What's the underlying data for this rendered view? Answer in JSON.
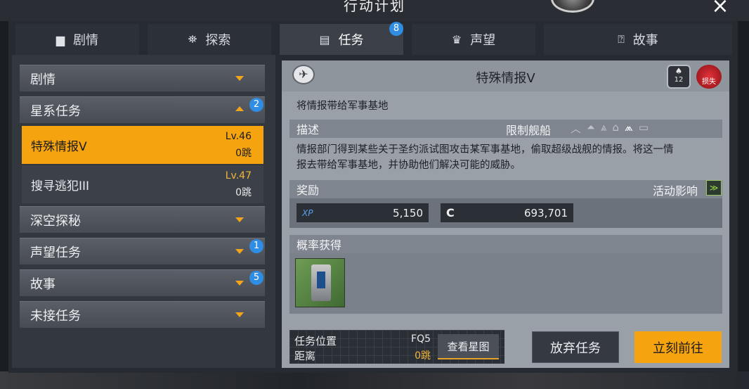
{
  "window": {
    "title": "行动计划",
    "close_icon": "×"
  },
  "tabs": [
    {
      "label": "剧情",
      "icon": "book-icon"
    },
    {
      "label": "探索",
      "icon": "explore-icon"
    },
    {
      "label": "任务",
      "icon": "task-icon",
      "badge": "8",
      "active": true
    },
    {
      "label": "声望",
      "icon": "reputation-icon"
    },
    {
      "label": "故事",
      "icon": "story-icon"
    }
  ],
  "sidebar": {
    "categories": [
      {
        "label": "剧情"
      },
      {
        "label": "星系任务",
        "badge": "2",
        "expanded": true
      },
      {
        "label": "深空探秘"
      },
      {
        "label": "声望任务",
        "badge": "1"
      },
      {
        "label": "故事",
        "badge": "5"
      },
      {
        "label": "未接任务"
      }
    ],
    "quests": [
      {
        "name": "特殊情报V",
        "level": "Lv.46",
        "jumps": "0跳",
        "selected": true
      },
      {
        "name": "搜寻逃犯III",
        "level": "Lv.47",
        "jumps": "0跳"
      }
    ]
  },
  "detail": {
    "title": "特殊情报V",
    "rank_text": "12",
    "danger_text": "损失",
    "objective_text": "将情报带给军事基地",
    "description_header": "描述",
    "restricted_ships_label": "限制舰船",
    "description_line1": "情报部门得到某些关于圣约派试图攻击某军事基地，偷取超级战舰的情报。将这一情",
    "description_line2": "报去带给军事基地，并协助他们解决可能的威胁。",
    "reward_header": "奖励",
    "activity_label": "活动影响",
    "rewards": [
      {
        "key": "XP",
        "value": "5,150"
      },
      {
        "key": "C",
        "value": "693,701"
      }
    ],
    "probability_header": "概率获得"
  },
  "footer": {
    "location_label": "任务位置",
    "distance_label": "距离",
    "location_value": "FQ5",
    "distance_value": "0跳",
    "view_starmap": "查看星图",
    "abandon": "放弃任务",
    "go_now": "立刻前往"
  },
  "colors": {
    "accent": "#f5a40f",
    "badge": "#2f8de4",
    "level": "#f2b63a"
  }
}
